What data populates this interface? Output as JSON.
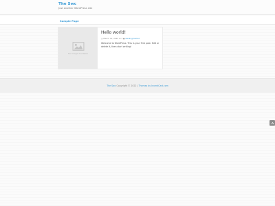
{
  "header": {
    "site_title": "The Swc",
    "site_description": "Just another WordPress site"
  },
  "nav": {
    "items": [
      {
        "label": "Sample Page"
      }
    ]
  },
  "post": {
    "title": "Hello world!",
    "date": "March 31, 2022",
    "comment_count": "1",
    "author": "sterlingmarket",
    "excerpt": "Welcome to WordPress. This is your first post. Edit or delete it, then start writing!",
    "thumbnail_label": "No Image Available",
    "icons": {
      "date": "clock-icon",
      "comments": "comment-icon",
      "author": "user-icon",
      "thumbnail": "image-placeholder-icon"
    }
  },
  "footer": {
    "site_link": "The Swc",
    "copyright": "Copyright © 2022 |",
    "credit": "Themes by InventCart.com"
  },
  "scroll_button": {
    "icon": "chevron-up-icon"
  },
  "colors": {
    "accent": "#3b9bd6",
    "footer_bg": "#f0f0f0",
    "thumb_bg": "#e9e9e9"
  }
}
